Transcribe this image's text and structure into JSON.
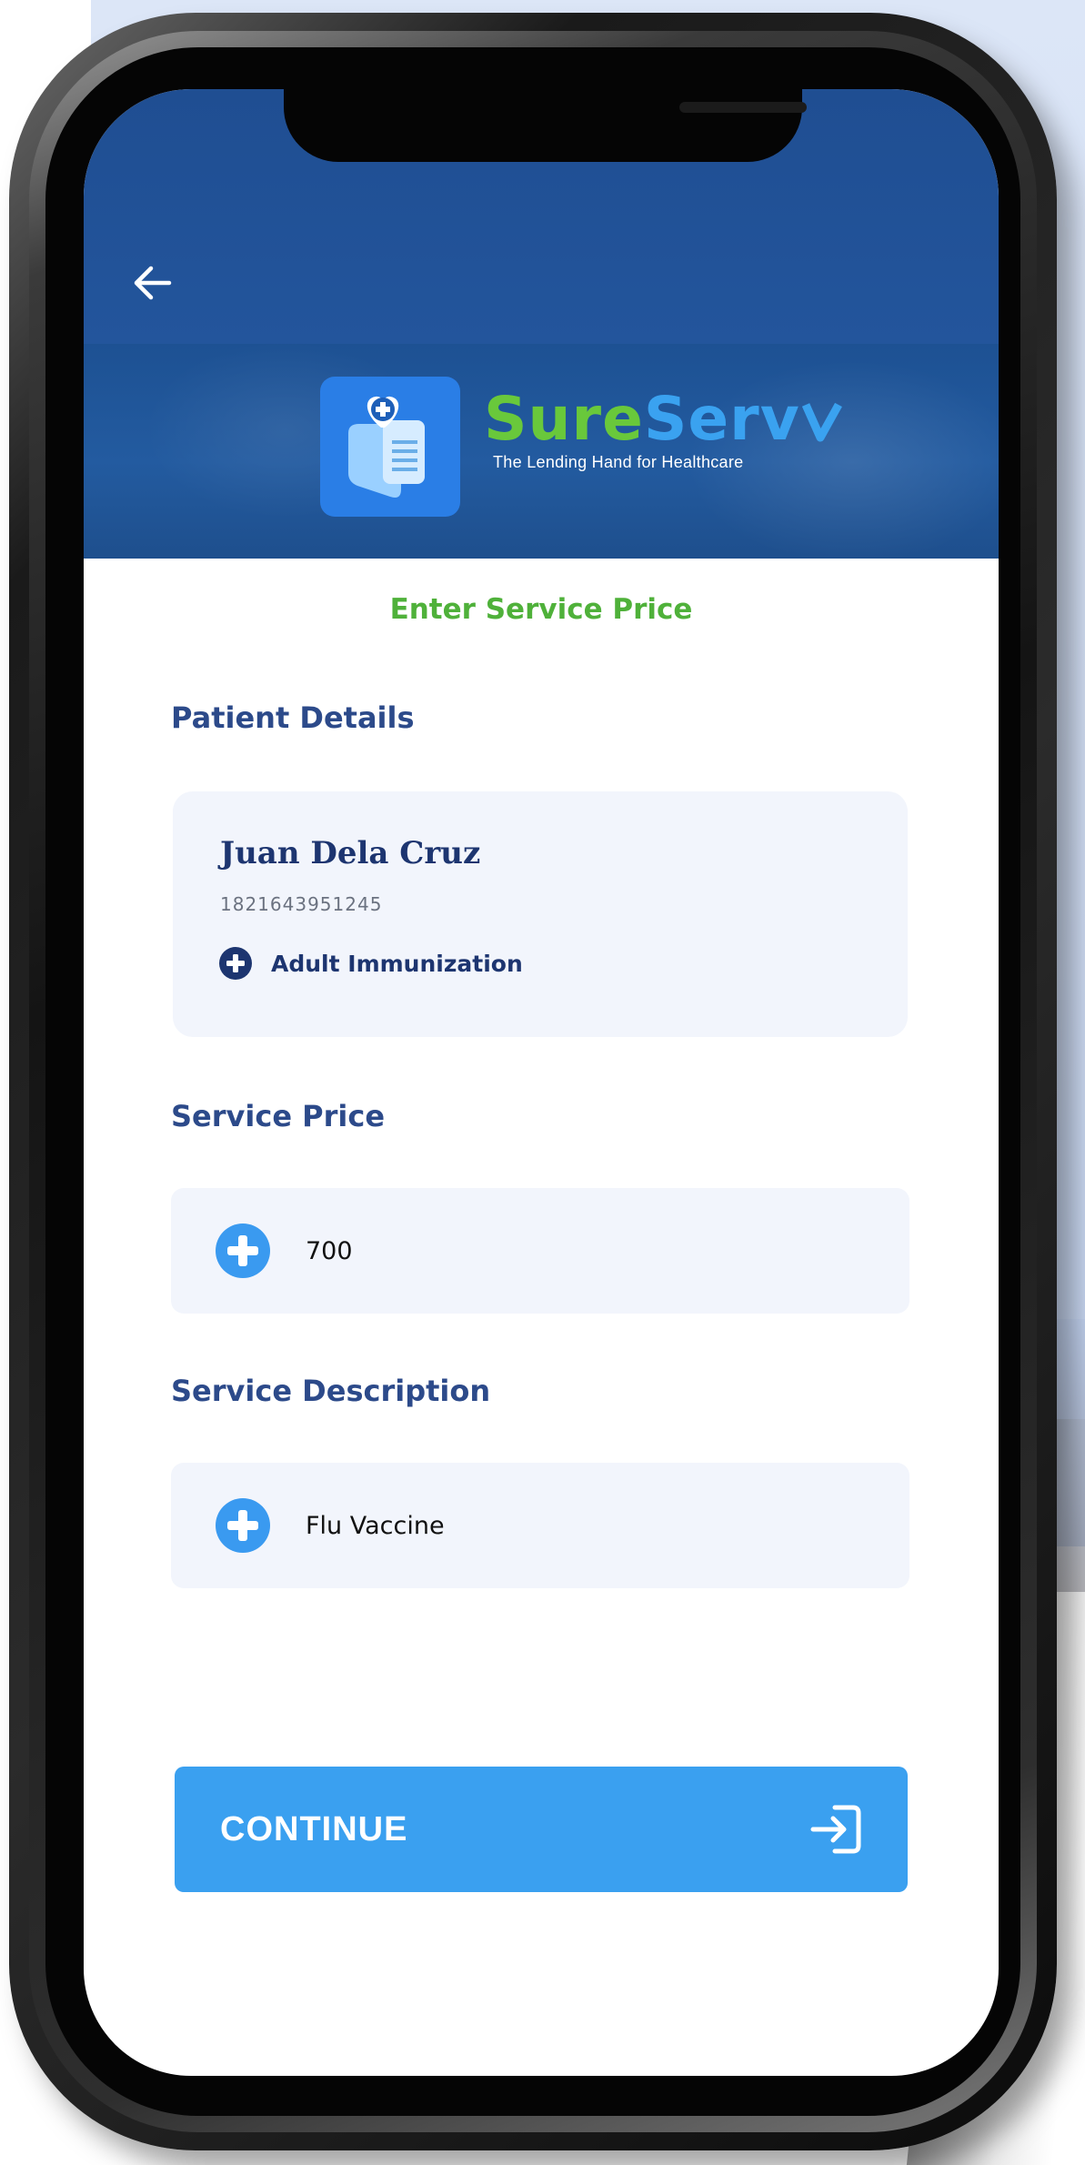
{
  "header": {
    "back_icon": "arrow-left-icon"
  },
  "brand": {
    "name_part1": "Sure",
    "name_part2": "Serv",
    "tagline": "The Lending Hand for Healthcare",
    "logo_icon": "medical-heart-document-icon",
    "colors": {
      "green": "#69c83b",
      "blue": "#3aa2f0",
      "header": "#1f4e92"
    }
  },
  "page": {
    "title": "Enter Service Price"
  },
  "patient_section": {
    "label": "Patient Details",
    "name": "Juan Dela Cruz",
    "id_number": "1821643951245",
    "service_icon": "plus-circle-icon",
    "service": "Adult Immunization"
  },
  "price_section": {
    "label": "Service Price",
    "icon": "plus-circle-icon",
    "value": "700"
  },
  "description_section": {
    "label": "Service Description",
    "icon": "plus-circle-icon",
    "value": "Flu Vaccine"
  },
  "continue_button": {
    "label": "CONTINUE",
    "icon": "sign-in-icon",
    "color": "#3aa0f0"
  }
}
